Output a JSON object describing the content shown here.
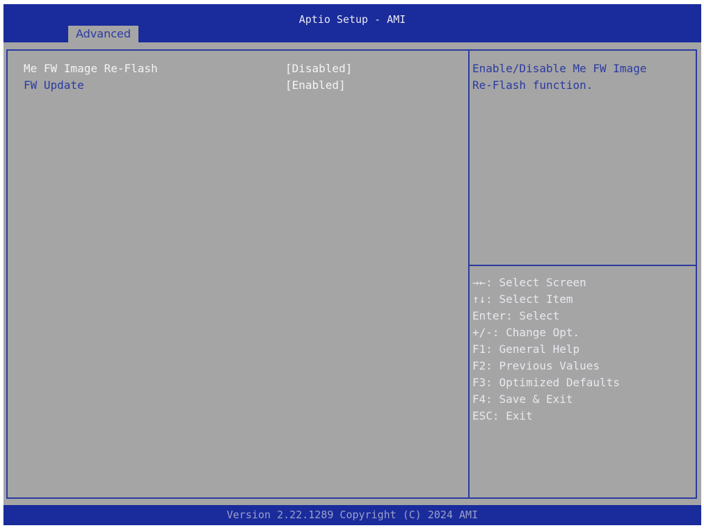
{
  "header": {
    "title": "Aptio Setup - AMI",
    "active_tab": "Advanced"
  },
  "settings": [
    {
      "label": "Me FW Image Re-Flash",
      "value": "[Disabled]",
      "selected": true
    },
    {
      "label": "FW Update",
      "value": "[Enabled]",
      "selected": false
    }
  ],
  "help": {
    "lines": [
      "Enable/Disable Me FW Image",
      "Re-Flash function."
    ]
  },
  "keys": [
    "→←: Select Screen",
    "↑↓: Select Item",
    "Enter: Select",
    "+/-: Change Opt.",
    "F1: General Help",
    "F2: Previous Values",
    "F3: Optimized Defaults",
    "F4: Save & Exit",
    "ESC: Exit"
  ],
  "footer": {
    "version": "Version 2.22.1289 Copyright (C) 2024 AMI"
  },
  "colors": {
    "header_bg": "#1a2b9b",
    "panel_bg": "#a5a5a5",
    "border": "#2b3aa0",
    "text_light": "#f4f4f4"
  }
}
